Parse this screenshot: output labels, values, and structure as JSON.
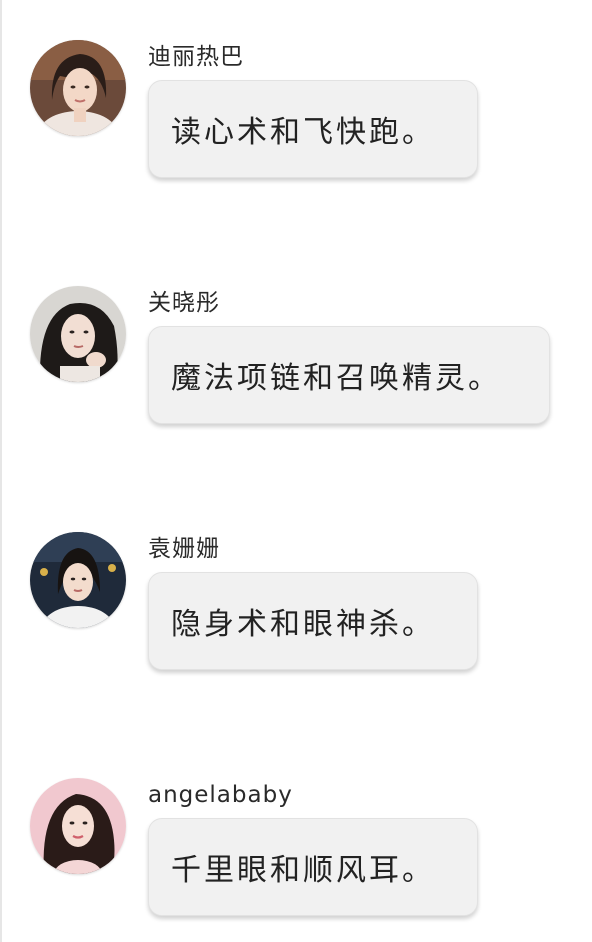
{
  "messages": [
    {
      "sender": "迪丽热巴",
      "text": "读心术和飞快跑。"
    },
    {
      "sender": "关晓彤",
      "text": "魔法项链和召唤精灵。"
    },
    {
      "sender": "袁姗姗",
      "text": "隐身术和眼神杀。"
    },
    {
      "sender": "angelababy",
      "text": "千里眼和顺风耳。"
    }
  ],
  "colors": {
    "bubble": "#f1f1f1",
    "text": "#222222",
    "background": "#ffffff"
  }
}
